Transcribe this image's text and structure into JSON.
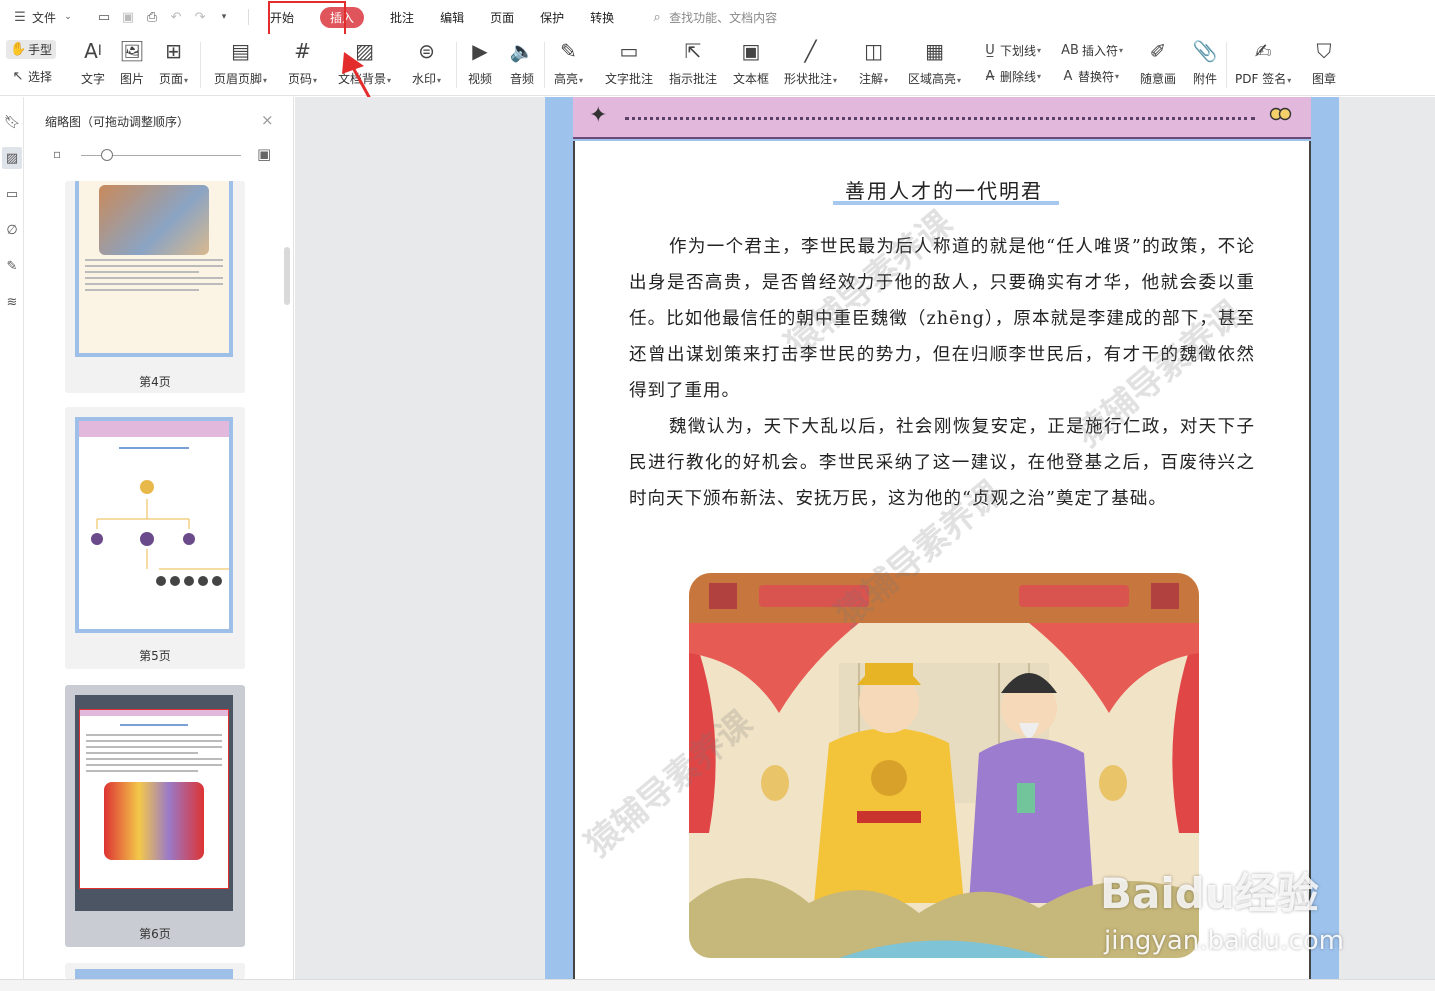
{
  "menubar": {
    "file_label": "文件",
    "tabs": [
      "开始",
      "插入",
      "批注",
      "编辑",
      "页面",
      "保护",
      "转换"
    ],
    "active_tab": "插入",
    "search_placeholder": "查找功能、文档内容"
  },
  "ribbon": {
    "hand": "手型",
    "select": "选择",
    "text": "文字",
    "image": "图片",
    "page": "页面",
    "header_footer": "页眉页脚",
    "page_number": "页码",
    "background": "文档背景",
    "watermark": "水印",
    "video": "视频",
    "audio": "音频",
    "highlight": "高亮",
    "text_note": "文字批注",
    "pointer_note": "指示批注",
    "text_box": "文本框",
    "shape_note": "形状批注",
    "annotate": "注解",
    "area_highlight": "区域高亮",
    "underline": "下划线",
    "strikethrough": "删除线",
    "insert_char": "插入符",
    "replace_char": "替换符",
    "freehand": "随意画",
    "attachment": "附件",
    "pdf_sign": "PDF 签名",
    "stamp": "图章"
  },
  "thumbnails": {
    "title": "缩略图（可拖动调整顺序）",
    "pages": [
      {
        "label": "第4页"
      },
      {
        "label": "第5页"
      },
      {
        "label": "第6页"
      }
    ],
    "selected_page": "第6页"
  },
  "document": {
    "title": "善用人才的一代明君",
    "paragraphs": [
      "作为一个君主，李世民最为后人称道的就是他“任人唯贤”的政策，不论出身是否高贵，是否曾经效力于他的敌人，只要确实有才华，他就会委以重任。比如他最信任的朝中重臣魏徵（zhēng），原本就是李建成的部下，甚至还曾出谋划策来打击李世民的势力，但在归顺李世民后，有才干的魏徵依然得到了重用。",
      "魏徵认为，天下大乱以后，社会刚恢复安定，正是施行仁政，对天下子民进行教化的好机会。李世民采纳了这一建议，在他登基之后，百废待兴之时向天下颁布新法、安抚万民，这为他的“贞观之治”奠定了基础。"
    ]
  },
  "watermarks": {
    "text": "猿辅导素养课",
    "baidu_logo": "Baidu经验",
    "baidu_url": "jingyan.baidu.com"
  },
  "colors": {
    "accent_red": "#e0555c",
    "page_frame_blue": "#9dc2ec",
    "header_pink": "#e2b8dc"
  }
}
